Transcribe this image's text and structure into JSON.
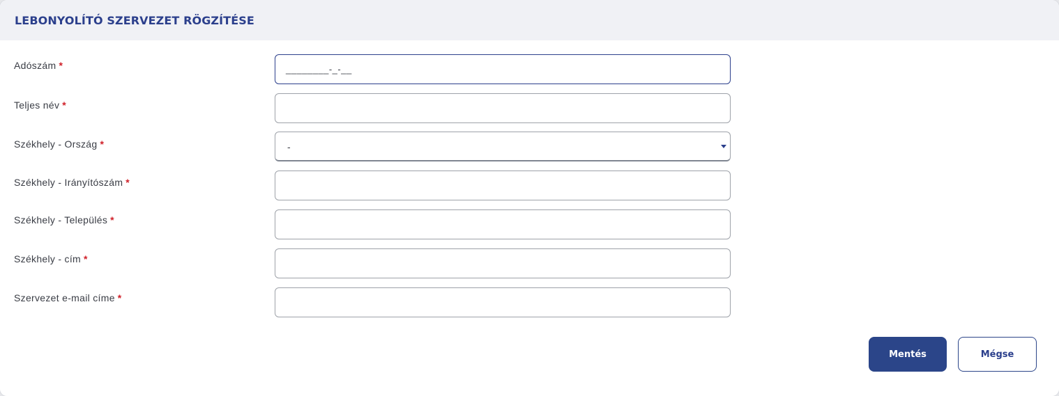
{
  "dialog": {
    "title": "LEBONYOLÍTÓ SZERVEZET RÖGZÍTÉSE"
  },
  "form": {
    "required_marker": "*",
    "tax_number": {
      "label": "Adószám",
      "mask": "________-_-__",
      "value": ""
    },
    "full_name": {
      "label": "Teljes név",
      "value": ""
    },
    "country": {
      "label": "Székhely - Ország",
      "selected": "-"
    },
    "postal_code": {
      "label": "Székhely - Irányítószám",
      "value": ""
    },
    "city": {
      "label": "Székhely - Település",
      "value": ""
    },
    "address": {
      "label": "Székhely - cím",
      "value": ""
    },
    "email": {
      "label": "Szervezet e-mail címe",
      "value": ""
    }
  },
  "actions": {
    "save_label": "Mentés",
    "cancel_label": "Mégse"
  },
  "colors": {
    "brand": "#2b3f8c",
    "required": "#d0212a",
    "header_bg": "#f0f1f5"
  }
}
